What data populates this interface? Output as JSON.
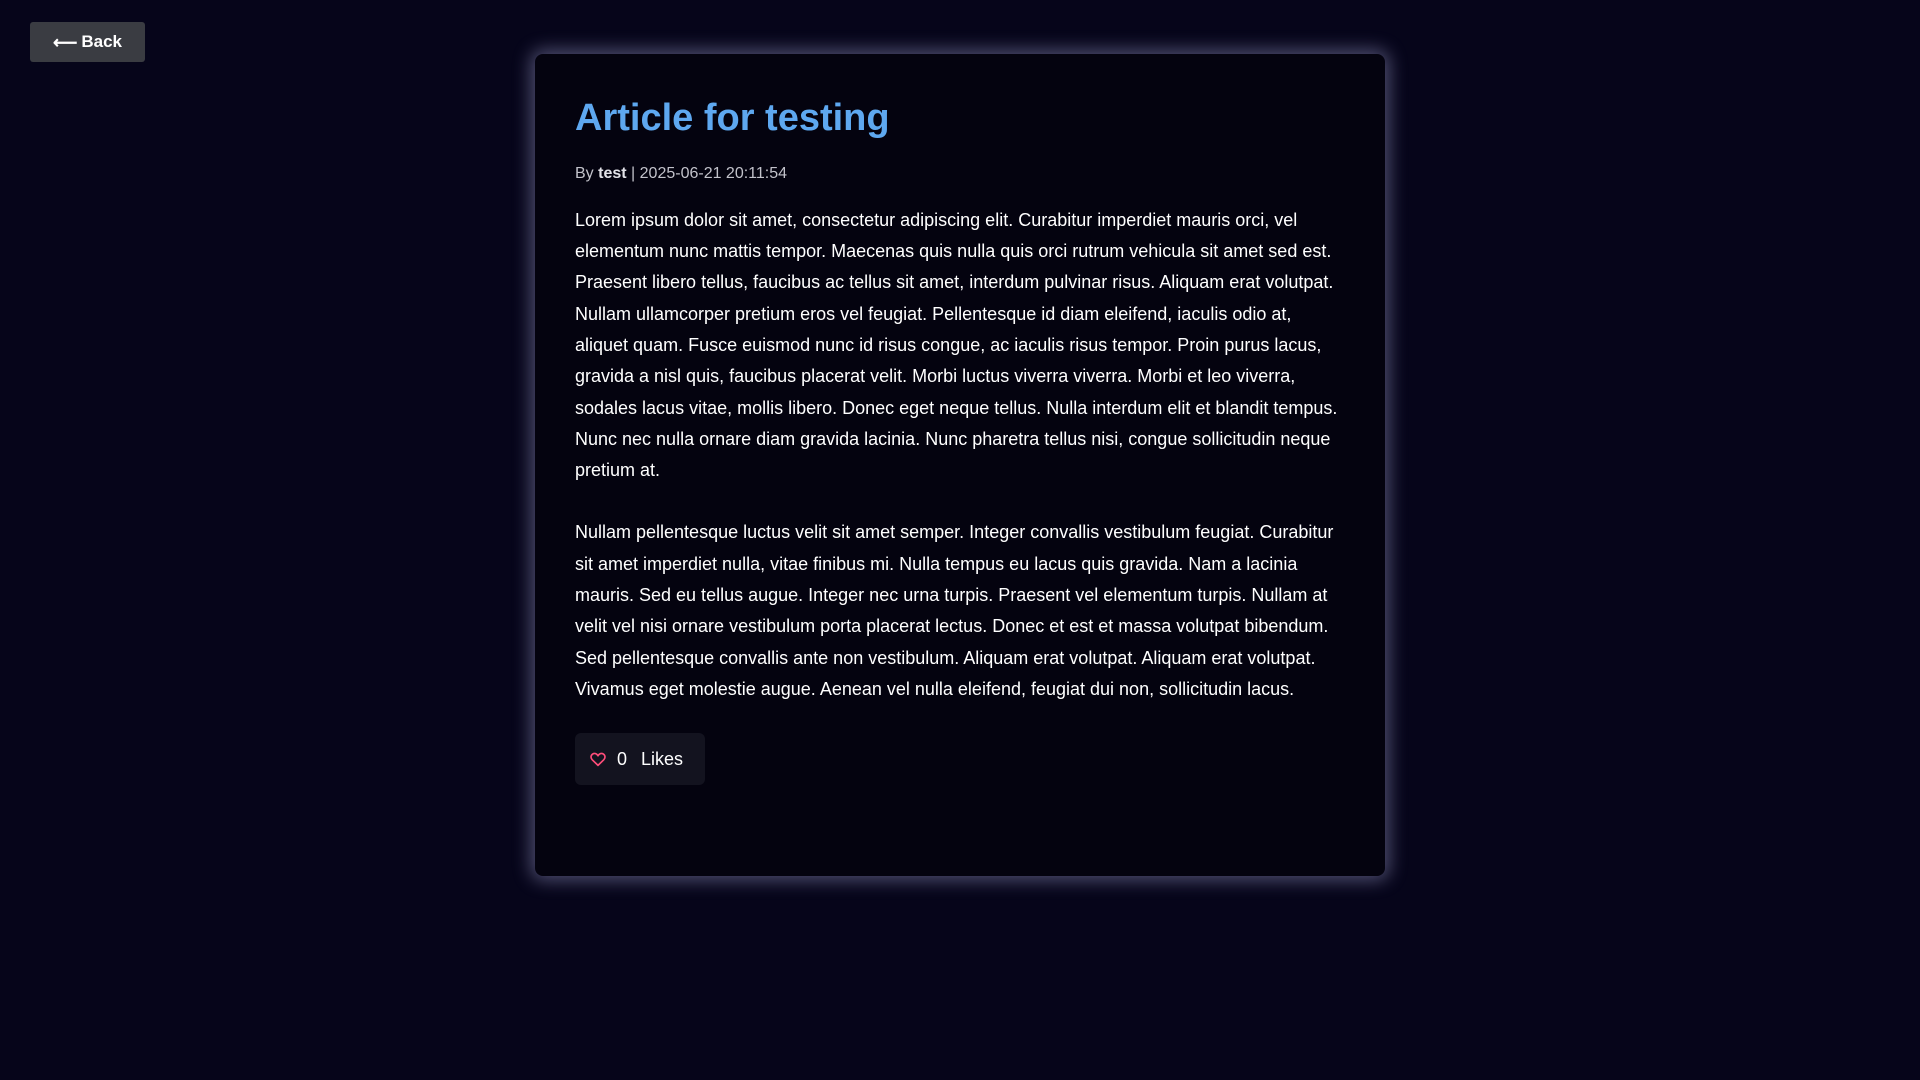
{
  "nav": {
    "back_arrow": "⟵",
    "back_label": "Back"
  },
  "article": {
    "title": "Article for testing",
    "byline_prefix": "By",
    "author": "test",
    "separator": "|",
    "timestamp": "2025-06-21 20:11:54",
    "paragraphs": [
      "Lorem ipsum dolor sit amet, consectetur adipiscing elit. Curabitur imperdiet mauris orci, vel elementum nunc mattis tempor. Maecenas quis nulla quis orci rutrum vehicula sit amet sed est. Praesent libero tellus, faucibus ac tellus sit amet, interdum pulvinar risus. Aliquam erat volutpat. Nullam ullamcorper pretium eros vel feugiat. Pellentesque id diam eleifend, iaculis odio at, aliquet quam. Fusce euismod nunc id risus congue, ac iaculis risus tempor. Proin purus lacus, gravida a nisl quis, faucibus placerat velit. Morbi luctus viverra viverra. Morbi et leo viverra, sodales lacus vitae, mollis libero. Donec eget neque tellus. Nulla interdum elit et blandit tempus. Nunc nec nulla ornare diam gravida lacinia. Nunc pharetra tellus nisi, congue sollicitudin neque pretium at.",
      "Nullam pellentesque luctus velit sit amet semper. Integer convallis vestibulum feugiat. Curabitur sit amet imperdiet nulla, vitae finibus mi. Nulla tempus eu lacus quis gravida. Nam a lacinia mauris. Sed eu tellus augue. Integer nec urna turpis. Praesent vel elementum turpis. Nullam at velit vel nisi ornare vestibulum porta placerat lectus. Donec et est et massa volutpat bibendum. Sed pellentesque convallis ante non vestibulum. Aliquam erat volutpat. Aliquam erat volutpat. Vivamus eget molestie augue. Aenean vel nulla eleifend, feugiat dui non, sollicitudin lacus."
    ]
  },
  "likes": {
    "icon": "heart-icon",
    "count": "0",
    "label": "Likes"
  },
  "colors": {
    "background": "#06051a",
    "card": "#04030f",
    "title": "#5ea8f0",
    "heart": "#ff4d7a",
    "button": "#3a3c42"
  }
}
